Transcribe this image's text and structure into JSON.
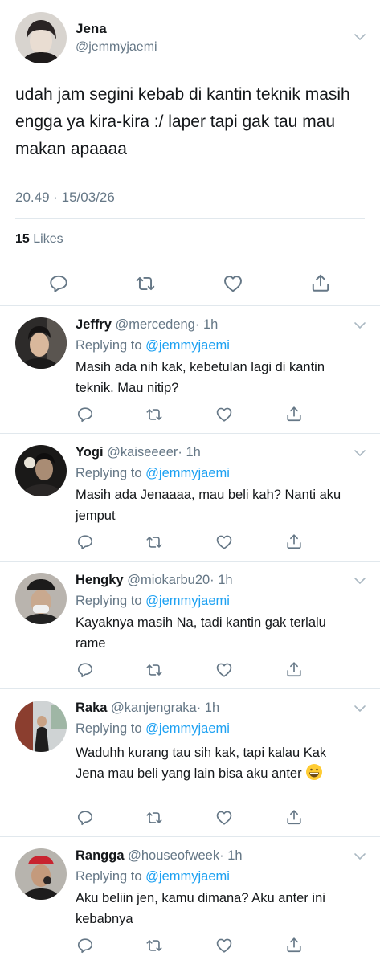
{
  "main_tweet": {
    "name": "Jena",
    "handle": "@jemmyjaemi",
    "text": "udah jam segini kebab di kantin teknik masih engga ya kira-kira :/ laper tapi gak tau mau makan apaaaa",
    "timestamp": "20.49 · 15/03/26",
    "likes_count": "15",
    "likes_label": "Likes"
  },
  "replies": [
    {
      "name": "Jeffry",
      "handle": "@mercedeng",
      "time": "· 1h",
      "replying_label": "Replying to",
      "replying_to": "@jemmyjaemi",
      "text": "Masih ada nih kak, kebetulan lagi di kantin teknik. Mau nitip?"
    },
    {
      "name": "Yogi",
      "handle": "@kaiseeeer",
      "time": "· 1h",
      "replying_label": "Replying to",
      "replying_to": "@jemmyjaemi",
      "text": "Masih ada Jenaaaa, mau beli kah? Nanti aku jemput"
    },
    {
      "name": "Hengky",
      "handle": "@miokarbu20",
      "time": "· 1h",
      "replying_label": "Replying to",
      "replying_to": "@jemmyjaemi",
      "text": "Kayaknya masih Na, tadi kantin gak terlalu rame"
    },
    {
      "name": "Raka",
      "handle": "@kanjengraka",
      "time": "· 1h",
      "replying_label": "Replying to",
      "replying_to": "@jemmyjaemi",
      "text": "Waduhh kurang tau sih kak, tapi kalau Kak Jena mau beli yang lain bisa aku anter",
      "emoji": "grinning-face"
    },
    {
      "name": "Rangga",
      "handle": "@houseofweek",
      "time": "· 1h",
      "replying_label": "Replying to",
      "replying_to": "@jemmyjaemi",
      "text": "Aku beliin jen, kamu dimana? Aku anter ini kebabnya"
    }
  ],
  "icons": {
    "reply": "reply-icon",
    "retweet": "retweet-icon",
    "like": "heart-icon",
    "share": "share-icon",
    "more": "chevron-down-icon"
  },
  "colors": {
    "text": "#14171a",
    "secondary": "#657786",
    "link": "#1da1f2",
    "divider": "#e1e8ed"
  }
}
